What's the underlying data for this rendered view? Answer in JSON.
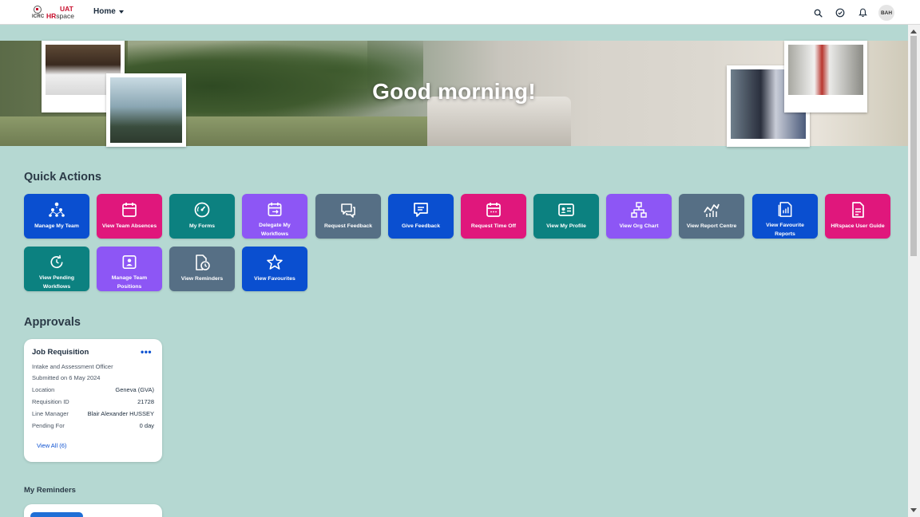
{
  "shell": {
    "logo_org": "ICRC",
    "logo_env": "UAT",
    "logo_app_hr": "HR",
    "logo_app_space": "space",
    "home_menu": "Home",
    "avatar_initials": "BAH",
    "icons": [
      "search-icon",
      "tasks-icon",
      "bell-icon"
    ]
  },
  "banner": {
    "greeting": "Good morning!"
  },
  "quick_actions": {
    "title": "Quick Actions",
    "tiles": [
      {
        "label": "Manage My Team",
        "color": "#0a4fd0",
        "icon": "org-people-icon"
      },
      {
        "label": "View Team Absences",
        "color": "#e0177c",
        "icon": "calendar-icon"
      },
      {
        "label": "My Forms",
        "color": "#0c8180",
        "icon": "gauge-icon"
      },
      {
        "label": "Delegate My Workflows",
        "color": "#8d56f5",
        "icon": "calendar-arrow-icon"
      },
      {
        "label": "Request Feedback",
        "color": "#566f85",
        "icon": "chat-bubbles-icon"
      },
      {
        "label": "Give Feedback",
        "color": "#0a4fd0",
        "icon": "comment-icon"
      },
      {
        "label": "Request Time Off",
        "color": "#e0177c",
        "icon": "calendar-grid-icon"
      },
      {
        "label": "View My Profile",
        "color": "#0c8180",
        "icon": "id-card-icon"
      },
      {
        "label": "View Org Chart",
        "color": "#8d56f5",
        "icon": "org-chart-icon"
      },
      {
        "label": "View Report Centre",
        "color": "#566f85",
        "icon": "line-chart-icon"
      },
      {
        "label": "View Favourite Reports",
        "color": "#0a4fd0",
        "icon": "report-icon"
      },
      {
        "label": "HRspace User Guide",
        "color": "#e0177c",
        "icon": "document-icon"
      },
      {
        "label": "View Pending Workflows",
        "color": "#0c8180",
        "icon": "refresh-clock-icon"
      },
      {
        "label": "Manage Team Positions",
        "color": "#8d56f5",
        "icon": "person-frame-icon"
      },
      {
        "label": "View Reminders",
        "color": "#566f85",
        "icon": "document-clock-icon"
      },
      {
        "label": "View Favourites",
        "color": "#0a4fd0",
        "icon": "star-icon"
      }
    ]
  },
  "approvals": {
    "title": "Approvals",
    "card": {
      "title": "Job Requisition",
      "subtitle": "Intake and Assessment Officer",
      "submitted": "Submitted on 6 May 2024",
      "rows": [
        {
          "label": "Location",
          "value": "Geneva (GVA)"
        },
        {
          "label": "Requisition ID",
          "value": "21728"
        },
        {
          "label": "Line Manager",
          "value": "Blair Alexander HUSSEY"
        },
        {
          "label": "Pending For",
          "value": "0 day"
        }
      ],
      "link": "View All (6)"
    }
  },
  "reminders": {
    "title": "My Reminders"
  }
}
